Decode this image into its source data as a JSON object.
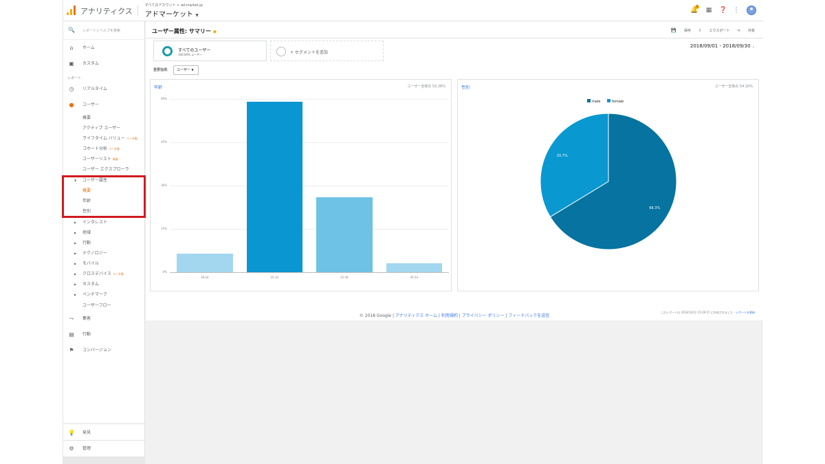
{
  "topbar": {
    "app_name": "アナリティクス",
    "account_crumb": "すべてのアカウント > ad-market.jp",
    "property_name": "アドマーケット",
    "notification_count": "1"
  },
  "sidebar": {
    "search_placeholder": "レポートとヘルプを検索",
    "home": "ホーム",
    "custom": "カスタム",
    "reports_section": "レポート",
    "realtime": "リアルタイム",
    "audience": "ユーザー",
    "audience_items": [
      {
        "label": "概要",
        "badge": ""
      },
      {
        "label": "アクティブ ユーザー",
        "badge": ""
      },
      {
        "label": "ライフタイム バリュー",
        "badge": "ベータ版"
      },
      {
        "label": "コホート分析",
        "badge": "ベータ版"
      },
      {
        "label": "ユーザーリスト",
        "badge": "新規"
      },
      {
        "label": "ユーザー エクスプローラ",
        "badge": ""
      }
    ],
    "demographics": "ユーザー属性",
    "demographics_items": [
      "概要",
      "年齢",
      "性別"
    ],
    "collapsed_items": [
      {
        "label": "インタレスト",
        "badge": ""
      },
      {
        "label": "地域",
        "badge": ""
      },
      {
        "label": "行動",
        "badge": ""
      },
      {
        "label": "テクノロジー",
        "badge": ""
      },
      {
        "label": "モバイル",
        "badge": ""
      },
      {
        "label": "クロスデバイス",
        "badge": "ベータ版"
      },
      {
        "label": "カスタム",
        "badge": ""
      },
      {
        "label": "ベンチマーク",
        "badge": ""
      }
    ],
    "users_flow": "ユーザーフロー",
    "acquisition": "集客",
    "behavior": "行動",
    "conversions": "コンバージョン",
    "discover": "発見",
    "admin": "管理"
  },
  "header": {
    "title": "ユーザー属性: サマリー",
    "save": "保存",
    "export": "エクスポート",
    "share": "共有"
  },
  "segments": {
    "active_name": "すべてのユーザー",
    "active_sub": "100.00% ユーザー",
    "add_label": "+ セグメントを追加"
  },
  "date_range": "2018/09/01 - 2018/09/30",
  "metric": {
    "label": "重要指標:",
    "selected": "ユーザー"
  },
  "age_card": {
    "title": "年齢",
    "share": "ユーザー全体の 52.26%"
  },
  "gender_card": {
    "title": "性別",
    "share": "ユーザー全体の 54.10%"
  },
  "colors": {
    "accent_orange": "#e8710a",
    "highlight_red": "#d1191f",
    "male": "#0673a0",
    "female": "#0a98d0"
  },
  "chart_data": [
    {
      "type": "bar",
      "title": "年齢",
      "categories": [
        "18-24",
        "25-34",
        "35-44",
        "45-54"
      ],
      "values": [
        6.5,
        59,
        26,
        3
      ],
      "ylim": [
        0,
        60
      ],
      "yticks": [
        "0%",
        "15%",
        "30%",
        "45%",
        "60%"
      ],
      "colors": [
        "#a2d7ef",
        "#0a96d0",
        "#6dc2e5",
        "#a2d7ef"
      ]
    },
    {
      "type": "pie",
      "title": "性別",
      "labels": [
        "male",
        "female"
      ],
      "values": [
        66.3,
        33.7
      ],
      "value_labels": [
        "66.3%",
        "33.7%"
      ],
      "colors": [
        "#0673a0",
        "#0a98d0"
      ],
      "legend": "top-center"
    }
  ],
  "report_footer": {
    "text": "このレポートは 2018/10/12 15:09:57 に作成されました -",
    "link": "レポートを更新"
  },
  "footer": {
    "copyright": "© 2018 Google",
    "links": [
      "アナリティクス ホーム",
      "利用規約",
      "プライバシー ポリシー",
      "フィードバックを送信"
    ]
  }
}
